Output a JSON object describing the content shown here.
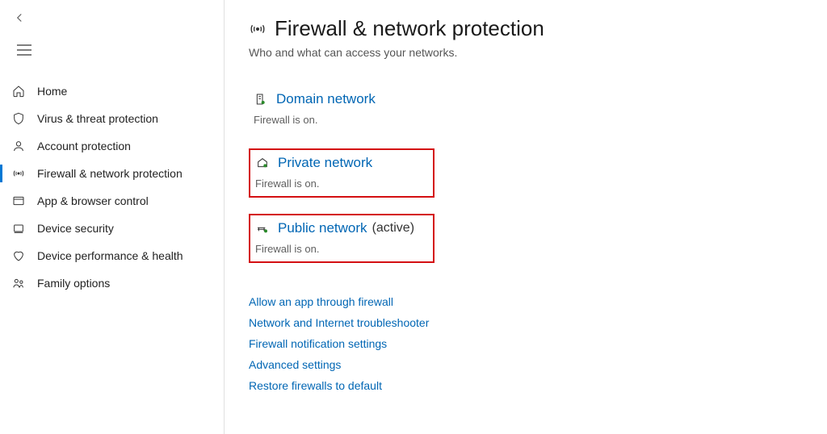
{
  "sidebar": {
    "items": [
      {
        "label": "Home"
      },
      {
        "label": "Virus & threat protection"
      },
      {
        "label": "Account protection"
      },
      {
        "label": "Firewall & network protection"
      },
      {
        "label": "App & browser control"
      },
      {
        "label": "Device security"
      },
      {
        "label": "Device performance & health"
      },
      {
        "label": "Family options"
      }
    ]
  },
  "page": {
    "title": "Firewall & network protection",
    "subtitle": "Who and what can access your networks."
  },
  "networks": [
    {
      "title": "Domain network",
      "status": "Firewall is on.",
      "active": ""
    },
    {
      "title": "Private network",
      "status": "Firewall is on.",
      "active": ""
    },
    {
      "title": "Public network",
      "status": "Firewall is on.",
      "active": "(active)"
    }
  ],
  "links": [
    {
      "label": "Allow an app through firewall"
    },
    {
      "label": "Network and Internet troubleshooter"
    },
    {
      "label": "Firewall notification settings"
    },
    {
      "label": "Advanced settings"
    },
    {
      "label": "Restore firewalls to default"
    }
  ]
}
